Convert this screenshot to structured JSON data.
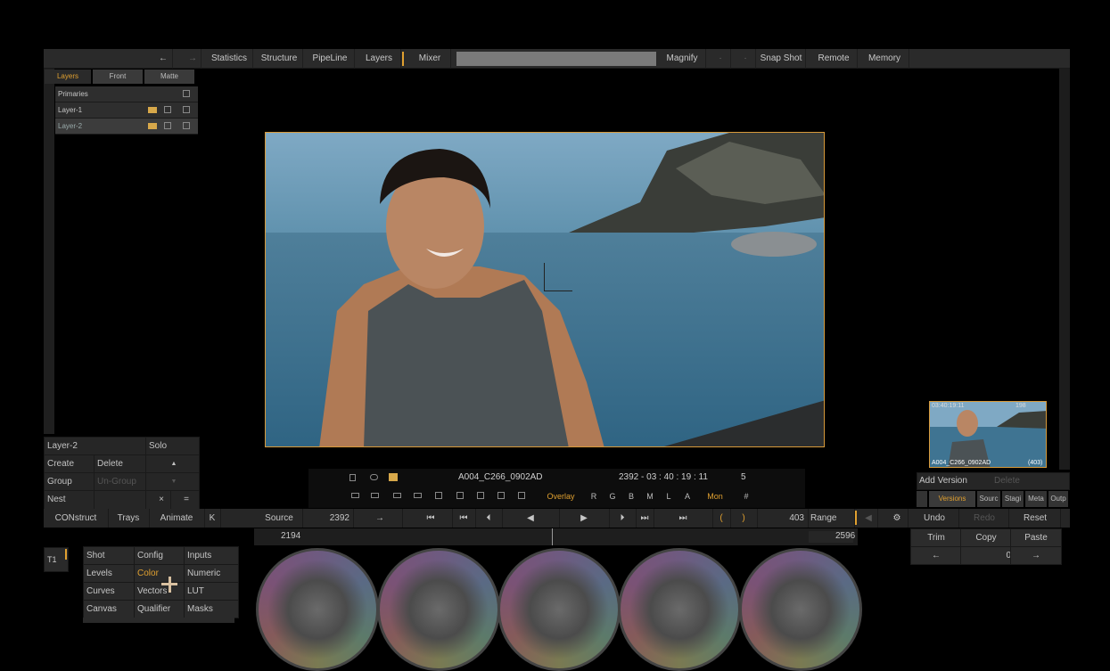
{
  "topbar": {
    "back": "←",
    "forward": "→",
    "items": [
      "Statistics",
      "Structure",
      "PipeLine",
      "Layers",
      "Mixer"
    ],
    "magnify": "Magnify",
    "dot1": "·",
    "dot2": "·",
    "snapshot": "Snap Shot",
    "remote": "Remote",
    "memory": "Memory"
  },
  "layers_panel": {
    "tabs": [
      "Layers",
      "Front",
      "Matte"
    ],
    "rows": [
      "Primaries",
      "Layer-1",
      "Layer-2"
    ],
    "current_layer": "Layer-2",
    "solo": "Solo",
    "create": "Create",
    "delete": "Delete",
    "group": "Group",
    "ungroup": "Un-Group",
    "nest": "Nest",
    "up_arrow": "▲",
    "down_arrow": "▼",
    "x_mark": "×",
    "eq_mark": "="
  },
  "transport": {
    "clip_name": "A004_C266_0902AD",
    "frame_tc": "2392  -  03 : 40 : 19 : 11",
    "count": "5",
    "overlay": "Overlay",
    "channels": [
      "R",
      "G",
      "B",
      "M",
      "L",
      "A"
    ],
    "mon": "Mon",
    "hash": "#"
  },
  "lowbar": {
    "construct": "CONstruct",
    "trays": "Trays",
    "animate": "Animate",
    "k": "K",
    "source": "Source",
    "frame": "2392",
    "end_frame": "403",
    "range": "Range",
    "undo": "Undo",
    "redo": "Redo",
    "reset": "Reset"
  },
  "scrub": {
    "start": "2194",
    "end": "2596"
  },
  "right": {
    "add_version": "Add Version",
    "delete": "Delete",
    "version_tabs": [
      "Versions",
      "Sourc",
      "Stagi",
      "Meta",
      "Outp"
    ],
    "trim": "Trim",
    "copy": "Copy",
    "paste": "Paste",
    "prev": "←",
    "value": "0",
    "next": "→"
  },
  "thumbnail": {
    "tc": "03:40:19:11",
    "frame": "198",
    "name": "A004_C266_0902AD",
    "count": "(403)"
  },
  "tools": {
    "t1": "T1",
    "grid": [
      [
        "Shot",
        "Config",
        "Inputs"
      ],
      [
        "Levels",
        "Color",
        "Numeric"
      ],
      [
        "Curves",
        "Vectors",
        "LUT"
      ],
      [
        "Canvas",
        "Qualifier",
        "Masks"
      ]
    ],
    "active": "Color"
  },
  "colors": {
    "accent": "#e0a030",
    "panel": "#2a2a2a",
    "background": "#000000"
  }
}
